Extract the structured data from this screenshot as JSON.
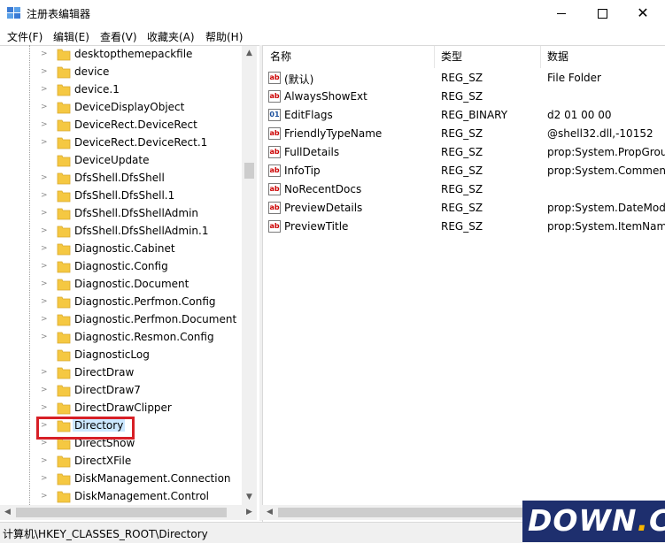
{
  "window": {
    "title": "注册表编辑器",
    "minimize": "—",
    "maximize": "☐",
    "close": "✕"
  },
  "menu": [
    "文件(F)",
    "编辑(E)",
    "查看(V)",
    "收藏夹(A)",
    "帮助(H)"
  ],
  "tree": {
    "items": [
      {
        "label": "desktopthemepackfile",
        "expandable": true
      },
      {
        "label": "device",
        "expandable": true
      },
      {
        "label": "device.1",
        "expandable": true
      },
      {
        "label": "DeviceDisplayObject",
        "expandable": true
      },
      {
        "label": "DeviceRect.DeviceRect",
        "expandable": true
      },
      {
        "label": "DeviceRect.DeviceRect.1",
        "expandable": true
      },
      {
        "label": "DeviceUpdate",
        "expandable": false
      },
      {
        "label": "DfsShell.DfsShell",
        "expandable": true
      },
      {
        "label": "DfsShell.DfsShell.1",
        "expandable": true
      },
      {
        "label": "DfsShell.DfsShellAdmin",
        "expandable": true
      },
      {
        "label": "DfsShell.DfsShellAdmin.1",
        "expandable": true
      },
      {
        "label": "Diagnostic.Cabinet",
        "expandable": true
      },
      {
        "label": "Diagnostic.Config",
        "expandable": true
      },
      {
        "label": "Diagnostic.Document",
        "expandable": true
      },
      {
        "label": "Diagnostic.Perfmon.Config",
        "expandable": true
      },
      {
        "label": "Diagnostic.Perfmon.Document",
        "expandable": true
      },
      {
        "label": "Diagnostic.Resmon.Config",
        "expandable": true
      },
      {
        "label": "DiagnosticLog",
        "expandable": false
      },
      {
        "label": "DirectDraw",
        "expandable": true
      },
      {
        "label": "DirectDraw7",
        "expandable": true
      },
      {
        "label": "DirectDrawClipper",
        "expandable": true
      },
      {
        "label": "Directory",
        "expandable": true,
        "selected": true
      },
      {
        "label": "DirectShow",
        "expandable": true
      },
      {
        "label": "DirectXFile",
        "expandable": true
      },
      {
        "label": "DiskManagement.Connection",
        "expandable": true
      },
      {
        "label": "DiskManagement.Control",
        "expandable": true
      }
    ]
  },
  "list": {
    "columns": {
      "name": "名称",
      "type": "类型",
      "data": "数据"
    },
    "rows": [
      {
        "name": "(默认)",
        "type": "REG_SZ",
        "data": "File Folder",
        "icon": "string-value-icon"
      },
      {
        "name": "AlwaysShowExt",
        "type": "REG_SZ",
        "data": "",
        "icon": "string-value-icon"
      },
      {
        "name": "EditFlags",
        "type": "REG_BINARY",
        "data": "d2 01 00 00",
        "icon": "binary-value-icon"
      },
      {
        "name": "FriendlyTypeName",
        "type": "REG_SZ",
        "data": "@shell32.dll,-10152",
        "icon": "string-value-icon"
      },
      {
        "name": "FullDetails",
        "type": "REG_SZ",
        "data": "prop:System.PropGrou",
        "icon": "string-value-icon"
      },
      {
        "name": "InfoTip",
        "type": "REG_SZ",
        "data": "prop:System.Comment",
        "icon": "string-value-icon"
      },
      {
        "name": "NoRecentDocs",
        "type": "REG_SZ",
        "data": "",
        "icon": "string-value-icon"
      },
      {
        "name": "PreviewDetails",
        "type": "REG_SZ",
        "data": "prop:System.DateMod",
        "icon": "string-value-icon"
      },
      {
        "name": "PreviewTitle",
        "type": "REG_SZ",
        "data": "prop:System.ItemNam",
        "icon": "string-value-icon"
      }
    ]
  },
  "status": {
    "path": "计算机\\HKEY_CLASSES_ROOT\\Directory"
  },
  "watermark": {
    "text": "DOWN",
    "dot": ".",
    "suffix": "CC"
  },
  "colors": {
    "highlight_border": "#d71f26",
    "selection": "#cce8ff",
    "folder": "#f5c842"
  }
}
